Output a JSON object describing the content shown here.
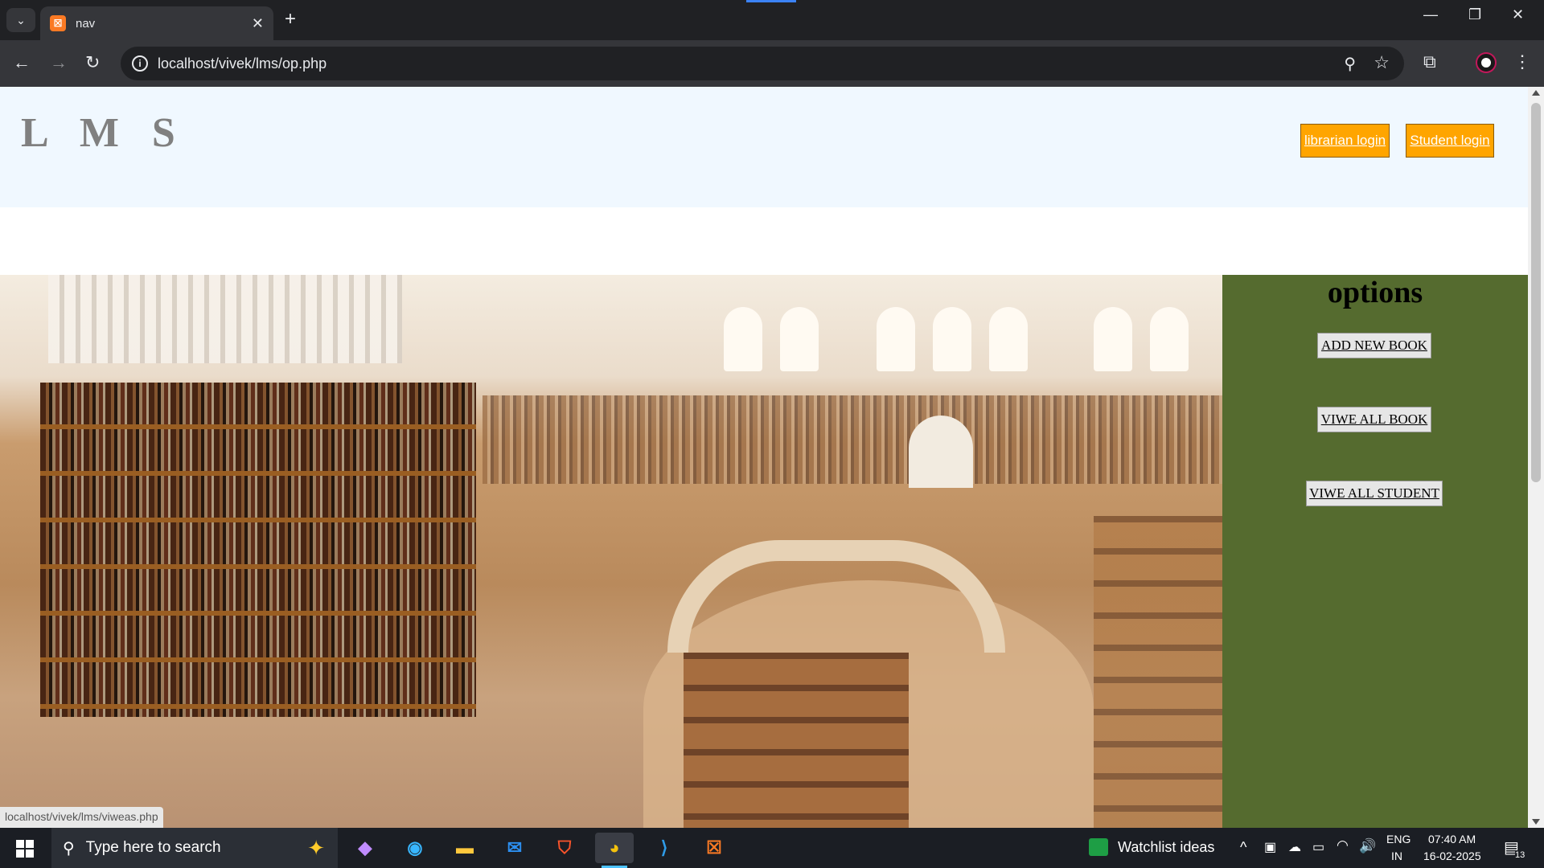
{
  "browser": {
    "tab_title": "nav",
    "favicon_text": "☒",
    "url": "localhost/vivek/lms/op.php",
    "status_url": "localhost/vivek/lms/viweas.php"
  },
  "page": {
    "logo": "L M S",
    "header_buttons": {
      "librarian": "librarian login",
      "student": "Student login"
    },
    "options": {
      "title": "options",
      "buttons": [
        "ADD NEW BOOK",
        "VIWE ALL BOOK",
        "VIWE ALL STUDENT"
      ]
    },
    "colors": {
      "header_bg": "#f0f8ff",
      "login_button": "#ffa500",
      "options_panel": "#556b2f"
    }
  },
  "taskbar": {
    "search_placeholder": "Type here to search",
    "watchlist": "Watchlist ideas",
    "lang_top": "ENG",
    "lang_bottom": "IN",
    "time": "07:40 AM",
    "date": "16-02-2025",
    "notification_count": "13"
  }
}
